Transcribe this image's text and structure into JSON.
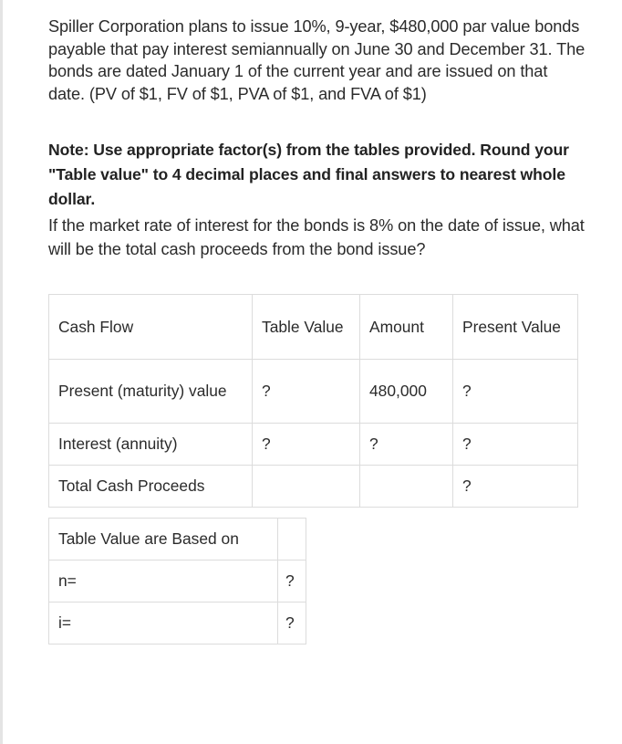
{
  "problem": {
    "intro": "Spiller Corporation plans to issue 10%, 9-year, $480,000 par value bonds payable that pay interest semiannually on June 30 and December 31. The bonds are dated January 1 of the current year and are issued on that date. (PV of $1, FV of $1, PVA of $1, and FVA of $1)",
    "note": "Note: Use appropriate factor(s) from the tables provided. Round your \"Table value\" to 4 decimal places and final answers to nearest whole dollar.",
    "question": "If the market rate of interest for the bonds is 8% on the date of issue, what will be the total cash proceeds from the bond issue?"
  },
  "cash_flow_table": {
    "headers": [
      "Cash Flow",
      "Table Value",
      "Amount",
      "Present Value"
    ],
    "rows": [
      {
        "cash_flow": "Present (maturity) value",
        "table_value": "?",
        "amount": "480,000",
        "present_value": "?"
      },
      {
        "cash_flow": "Interest (annuity)",
        "table_value": "?",
        "amount": "?",
        "present_value": "?"
      },
      {
        "cash_flow": "Total Cash Proceeds",
        "table_value": "",
        "amount": "",
        "present_value": "?"
      }
    ]
  },
  "basis_table": {
    "header": "Table Value are Based on",
    "header_value": "",
    "rows": [
      {
        "label": "n=",
        "value": "?"
      },
      {
        "label": "i=",
        "value": "?"
      }
    ]
  }
}
